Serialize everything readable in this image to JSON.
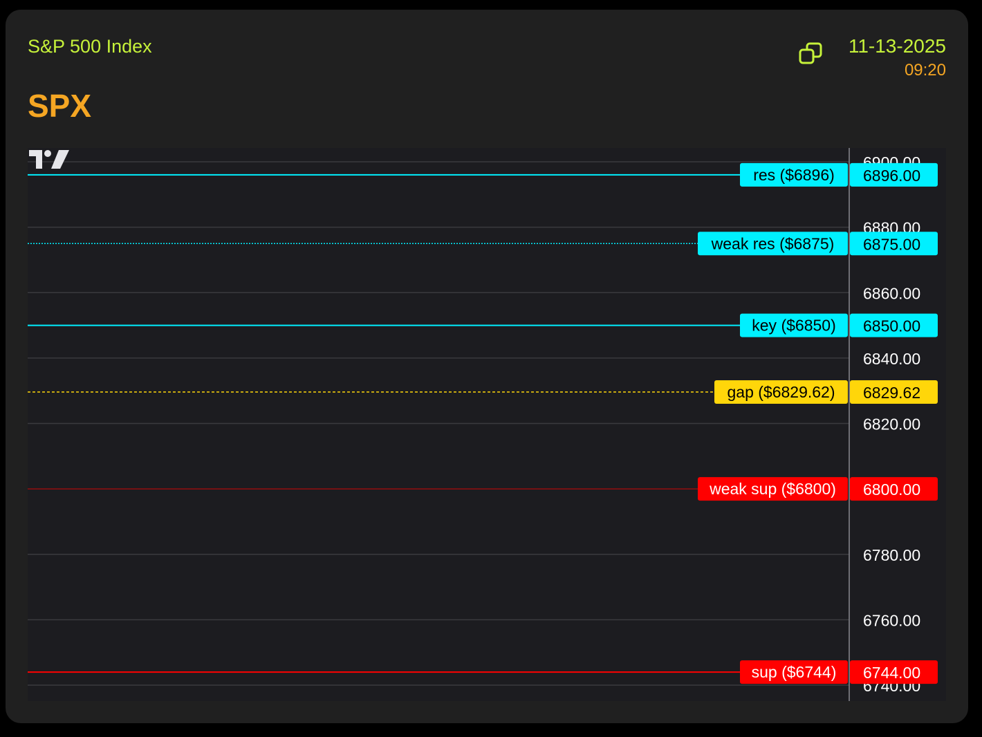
{
  "header": {
    "index_name": "S&P 500 Index",
    "ticker": "SPX",
    "date": "11-13-2025",
    "time": "09:20",
    "copy_icon": "copy-icon"
  },
  "colors": {
    "background": "#202020",
    "chart_background": "#1c1c20",
    "index_name": "#c6f23a",
    "ticker": "#f5a623",
    "date": "#c6f23a",
    "time": "#f5a623",
    "grid": "#3a3a3e",
    "axis_text": "#ffffff",
    "cyan": "#00f0ff",
    "yellow": "#ffd60a",
    "red": "#ff0000"
  },
  "chart_data": {
    "type": "line",
    "ylim": [
      6736,
      6904
    ],
    "grid": true,
    "y_ticks": [
      6900,
      6880,
      6860,
      6840,
      6820,
      6780,
      6760,
      6740
    ],
    "y_tick_labels": [
      "6900.00",
      "6880.00",
      "6860.00",
      "6840.00",
      "6820.00",
      "6780.00",
      "6760.00",
      "6740.00"
    ],
    "levels": [
      {
        "label": "res ($6896)",
        "value": 6896,
        "value_label": "6896.00",
        "color": "#00f0ff",
        "style": "solid"
      },
      {
        "label": "weak res ($6875)",
        "value": 6875,
        "value_label": "6875.00",
        "color": "#00f0ff",
        "style": "dotted"
      },
      {
        "label": "key ($6850)",
        "value": 6850,
        "value_label": "6850.00",
        "color": "#00f0ff",
        "style": "solid"
      },
      {
        "label": "gap ($6829.62)",
        "value": 6829.62,
        "value_label": "6829.62",
        "color": "#ffd60a",
        "style": "dashed"
      },
      {
        "label": "weak sup ($6800)",
        "value": 6800,
        "value_label": "6800.00",
        "color": "#ff0000",
        "style": "solid-thin"
      },
      {
        "label": "sup ($6744)",
        "value": 6744,
        "value_label": "6744.00",
        "color": "#ff0000",
        "style": "solid"
      }
    ]
  }
}
